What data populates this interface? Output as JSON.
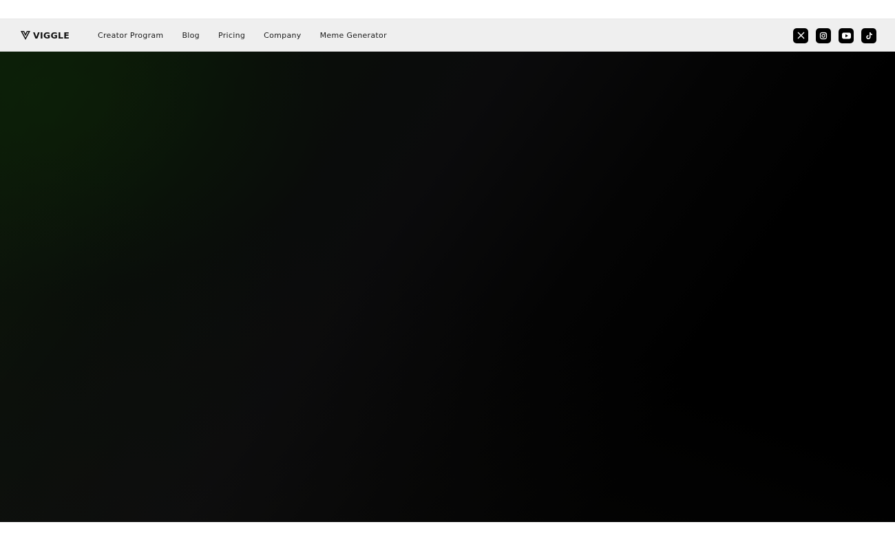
{
  "brand": {
    "name": "VIGGLE",
    "logo_icon": "viggle-v-logo-icon"
  },
  "nav": {
    "items": [
      {
        "label": "Creator Program"
      },
      {
        "label": "Blog"
      },
      {
        "label": "Pricing"
      },
      {
        "label": "Company"
      },
      {
        "label": "Meme Generator"
      }
    ]
  },
  "socials": [
    {
      "icon": "x-twitter-icon"
    },
    {
      "icon": "instagram-icon"
    },
    {
      "icon": "youtube-icon"
    },
    {
      "icon": "tiktok-icon"
    }
  ],
  "colors": {
    "navbar_bg": "#efefef",
    "hero_bg": "#000000",
    "hero_tint": "#0b1a08"
  }
}
